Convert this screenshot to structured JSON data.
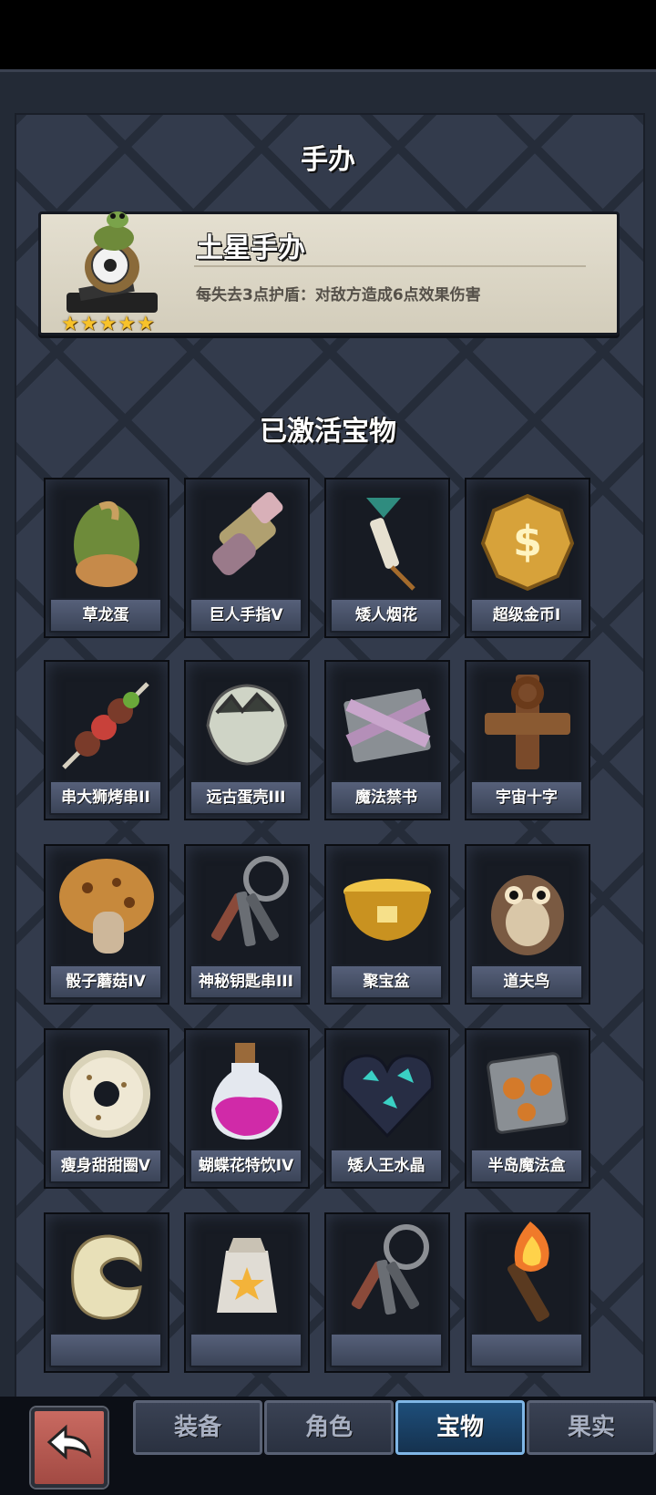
{
  "figure_section": {
    "title": "手办",
    "name": "土星手办",
    "description": "每失去3点护盾：对敌方造成6点效果伤害",
    "stars": 5
  },
  "treasure_section": {
    "title": "已激活宝物",
    "items": [
      {
        "label": "草龙蛋",
        "icon": "dragon-egg-icon"
      },
      {
        "label": "巨人手指V",
        "icon": "giant-finger-icon"
      },
      {
        "label": "矮人烟花",
        "icon": "firework-icon"
      },
      {
        "label": "超级金币I",
        "icon": "gold-coin-icon"
      },
      {
        "label": "串大狮烤串II",
        "icon": "skewer-icon"
      },
      {
        "label": "远古蛋壳III",
        "icon": "eggshell-icon"
      },
      {
        "label": "魔法禁书",
        "icon": "forbidden-book-icon"
      },
      {
        "label": "宇宙十字",
        "icon": "cosmic-cross-icon"
      },
      {
        "label": "骰子蘑菇IV",
        "icon": "mushroom-icon"
      },
      {
        "label": "神秘钥匙串III",
        "icon": "keychain-icon"
      },
      {
        "label": "聚宝盆",
        "icon": "treasure-bowl-icon"
      },
      {
        "label": "道夫鸟",
        "icon": "owl-icon"
      },
      {
        "label": "瘦身甜甜圈V",
        "icon": "donut-icon"
      },
      {
        "label": "蝴蝶花特饮IV",
        "icon": "potion-icon"
      },
      {
        "label": "矮人王水晶",
        "icon": "crystal-heart-icon"
      },
      {
        "label": "半岛魔法盒",
        "icon": "magic-box-icon"
      },
      {
        "label": "",
        "icon": "cream-swirl-icon"
      },
      {
        "label": "",
        "icon": "star-sack-icon"
      },
      {
        "label": "",
        "icon": "keychain-icon"
      },
      {
        "label": "",
        "icon": "torch-icon"
      }
    ]
  },
  "tabs": [
    {
      "label": "装备",
      "active": false
    },
    {
      "label": "角色",
      "active": false
    },
    {
      "label": "宝物",
      "active": true
    },
    {
      "label": "果实",
      "active": false
    }
  ],
  "back_button": {
    "icon": "back-arrow-icon"
  }
}
